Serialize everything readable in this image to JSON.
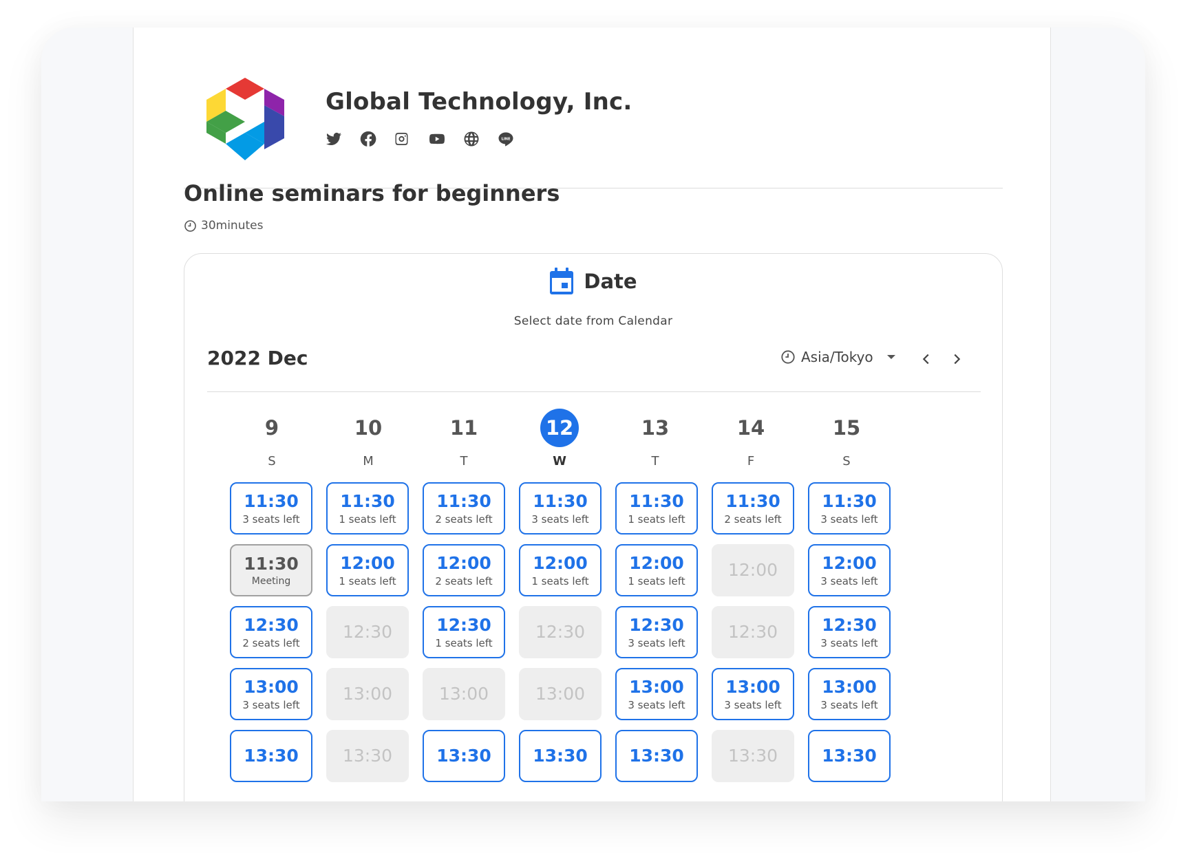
{
  "company": {
    "name": "Global Technology, Inc.",
    "socials": [
      {
        "icon": "twitter-icon"
      },
      {
        "icon": "facebook-icon"
      },
      {
        "icon": "instagram-icon"
      },
      {
        "icon": "youtube-icon"
      },
      {
        "icon": "globe-icon"
      },
      {
        "icon": "line-icon"
      }
    ]
  },
  "event": {
    "title": "Online seminars for beginners",
    "duration": "30minutes"
  },
  "calendar": {
    "heading": "Date",
    "subtitle": "Select date from Calendar",
    "month": "2022 Dec",
    "timezone": "Asia/Tokyo",
    "accent_color": "#1f72e8",
    "days": [
      {
        "num": "9",
        "weekday": "S",
        "selected": false
      },
      {
        "num": "10",
        "weekday": "M",
        "selected": false
      },
      {
        "num": "11",
        "weekday": "T",
        "selected": false
      },
      {
        "num": "12",
        "weekday": "W",
        "selected": true
      },
      {
        "num": "13",
        "weekday": "T",
        "selected": false
      },
      {
        "num": "14",
        "weekday": "F",
        "selected": false
      },
      {
        "num": "15",
        "weekday": "S",
        "selected": false
      }
    ],
    "slots": [
      [
        {
          "time": "11:30",
          "status": "open",
          "note": "3 seats left"
        },
        {
          "time": "11:30",
          "status": "meeting",
          "note": "Meeting"
        },
        {
          "time": "12:30",
          "status": "open",
          "note": "2 seats left"
        },
        {
          "time": "13:00",
          "status": "open",
          "note": "3 seats left"
        },
        {
          "time": "13:30",
          "status": "open",
          "note": ""
        }
      ],
      [
        {
          "time": "11:30",
          "status": "open",
          "note": "1 seats left"
        },
        {
          "time": "12:00",
          "status": "open",
          "note": "1 seats left"
        },
        {
          "time": "12:30",
          "status": "off",
          "note": ""
        },
        {
          "time": "13:00",
          "status": "off",
          "note": ""
        },
        {
          "time": "13:30",
          "status": "off",
          "note": ""
        }
      ],
      [
        {
          "time": "11:30",
          "status": "open",
          "note": "2 seats left"
        },
        {
          "time": "12:00",
          "status": "open",
          "note": "2 seats left"
        },
        {
          "time": "12:30",
          "status": "open",
          "note": "1 seats left"
        },
        {
          "time": "13:00",
          "status": "off",
          "note": ""
        },
        {
          "time": "13:30",
          "status": "open",
          "note": ""
        }
      ],
      [
        {
          "time": "11:30",
          "status": "open",
          "note": "3 seats left"
        },
        {
          "time": "12:00",
          "status": "open",
          "note": "1 seats left"
        },
        {
          "time": "12:30",
          "status": "off",
          "note": ""
        },
        {
          "time": "13:00",
          "status": "off",
          "note": ""
        },
        {
          "time": "13:30",
          "status": "open",
          "note": ""
        }
      ],
      [
        {
          "time": "11:30",
          "status": "open",
          "note": "1 seats left"
        },
        {
          "time": "12:00",
          "status": "open",
          "note": "1 seats left"
        },
        {
          "time": "12:30",
          "status": "open",
          "note": "3 seats left"
        },
        {
          "time": "13:00",
          "status": "open",
          "note": "3 seats left"
        },
        {
          "time": "13:30",
          "status": "open",
          "note": ""
        }
      ],
      [
        {
          "time": "11:30",
          "status": "open",
          "note": "2 seats left"
        },
        {
          "time": "12:00",
          "status": "off",
          "note": ""
        },
        {
          "time": "12:30",
          "status": "off",
          "note": ""
        },
        {
          "time": "13:00",
          "status": "open",
          "note": "3 seats left"
        },
        {
          "time": "13:30",
          "status": "off",
          "note": ""
        }
      ],
      [
        {
          "time": "11:30",
          "status": "open",
          "note": "3 seats left"
        },
        {
          "time": "12:00",
          "status": "open",
          "note": "3 seats left"
        },
        {
          "time": "12:30",
          "status": "open",
          "note": "3 seats left"
        },
        {
          "time": "13:00",
          "status": "open",
          "note": "3 seats left"
        },
        {
          "time": "13:30",
          "status": "open",
          "note": ""
        }
      ]
    ]
  }
}
